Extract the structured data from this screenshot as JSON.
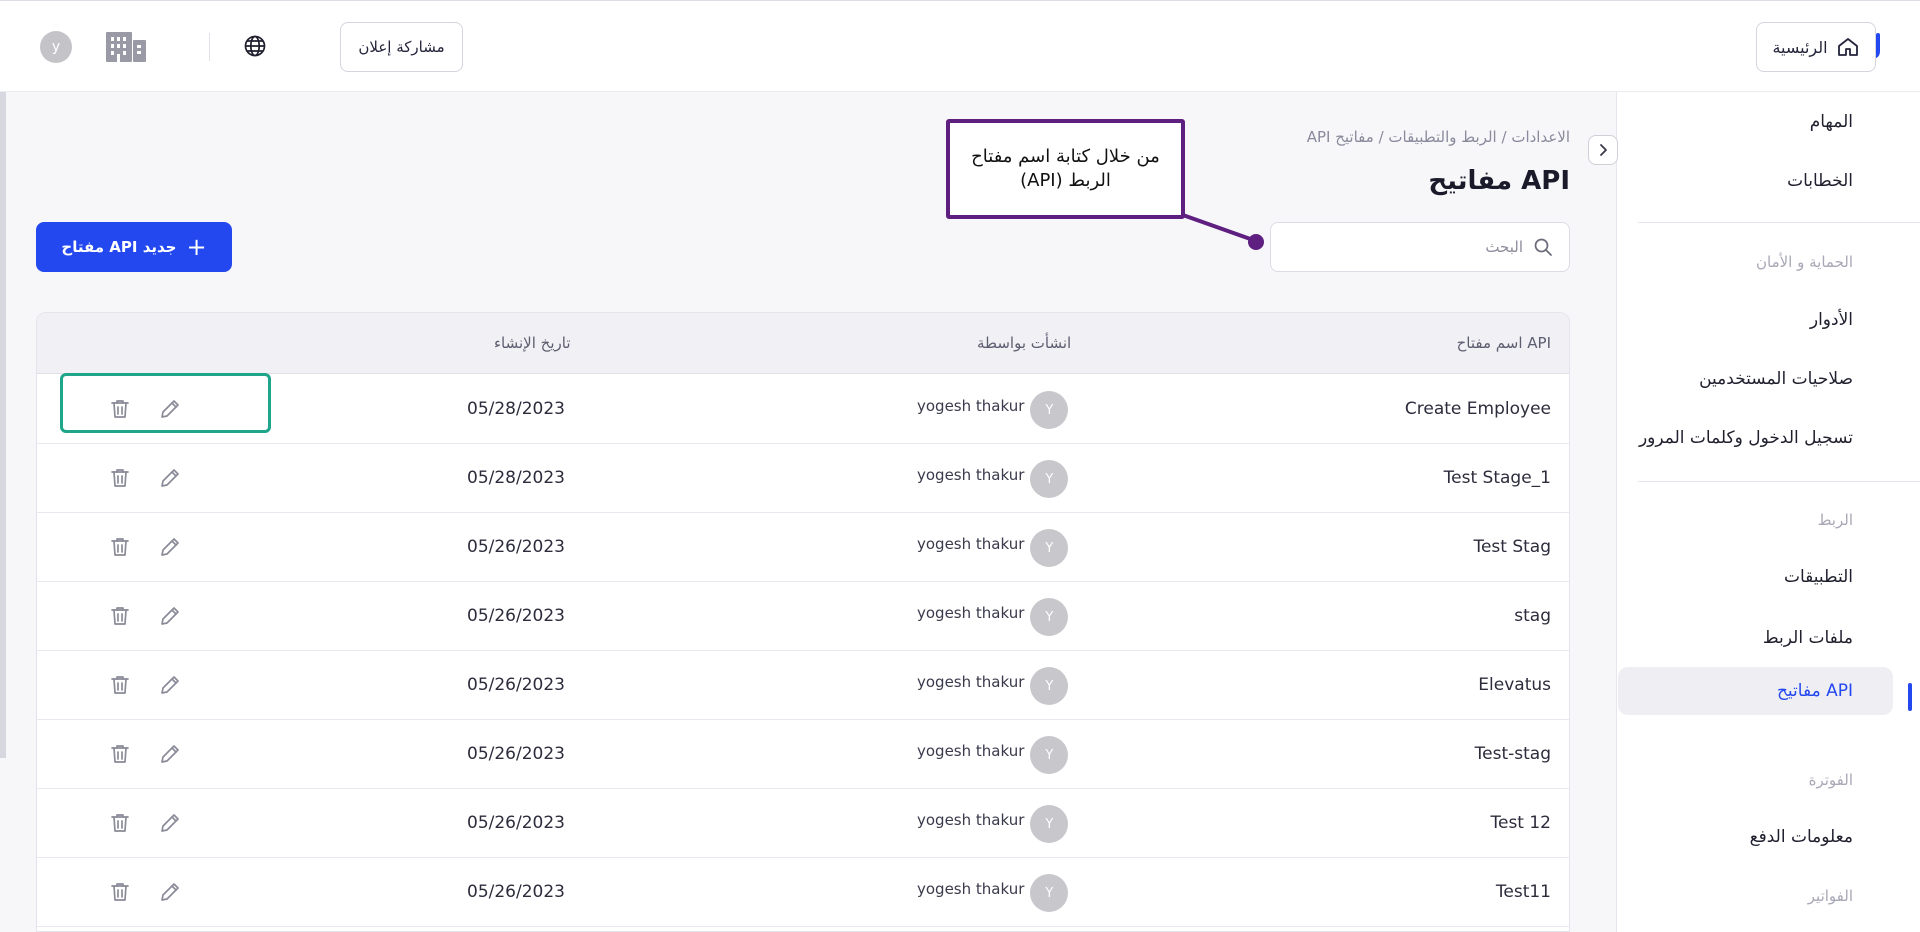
{
  "topbar": {
    "home_label": "الرئيسية",
    "ad_label": "مشاركة إعلان",
    "avatar_letter": "y"
  },
  "sidebar": {
    "items_top": [
      {
        "label": "المهام"
      },
      {
        "label": "الخطابات"
      }
    ],
    "security_heading": "الحماية و الأمان",
    "security_items": [
      {
        "label": "الأدوار"
      },
      {
        "label": "صلاحيات المستخدمين"
      },
      {
        "label": "تسجيل الدخول وكلمات المرور"
      }
    ],
    "integration_heading": "الربط",
    "integration_items": [
      {
        "label": "التطبيقات"
      },
      {
        "label": "ملفات الربط"
      },
      {
        "label": "مفاتيح API"
      }
    ],
    "billing_heading": "الفوترة",
    "billing_items": [
      {
        "label": "معلومات الدفع"
      }
    ],
    "invoices_heading": "الفواتير"
  },
  "page": {
    "breadcrumb": "الاعدادات / الربط والتطبيقات / مفاتيح API",
    "title": "مفاتيح API",
    "search_placeholder": "البحث",
    "new_button_label": "مفتاح API جديد"
  },
  "callout": {
    "text": "من خلال كتابة اسم مفتاح الربط (API)"
  },
  "table": {
    "columns": {
      "name": "اسم مفتاح API",
      "created_by": "انشأت بواسطة",
      "created_at": "تاريخ الإنشاء"
    },
    "rows": [
      {
        "name": "Create Employee",
        "user": "yogesh thakur",
        "avatar": "Y",
        "date": "05/28/2023"
      },
      {
        "name": "Test Stage_1",
        "user": "yogesh thakur",
        "avatar": "Y",
        "date": "05/28/2023"
      },
      {
        "name": "Test Stag",
        "user": "yogesh thakur",
        "avatar": "Y",
        "date": "05/26/2023"
      },
      {
        "name": "stag",
        "user": "yogesh thakur",
        "avatar": "Y",
        "date": "05/26/2023"
      },
      {
        "name": "Elevatus",
        "user": "yogesh thakur",
        "avatar": "Y",
        "date": "05/26/2023"
      },
      {
        "name": "Test-stag",
        "user": "yogesh thakur",
        "avatar": "Y",
        "date": "05/26/2023"
      },
      {
        "name": "Test 12",
        "user": "yogesh thakur",
        "avatar": "Y",
        "date": "05/26/2023"
      },
      {
        "name": "Test11",
        "user": "yogesh thakur",
        "avatar": "Y",
        "date": "05/26/2023"
      }
    ]
  },
  "colors": {
    "accent": "#2448f0",
    "callout_border": "#5e1f80",
    "highlight_border": "#1fa58a"
  },
  "icons": {
    "row_actions": [
      "trash-icon",
      "pencil-icon"
    ],
    "top": [
      "home-icon",
      "globe-icon",
      "building-icon",
      "search-icon",
      "plus-icon",
      "chevron-right-icon"
    ]
  }
}
